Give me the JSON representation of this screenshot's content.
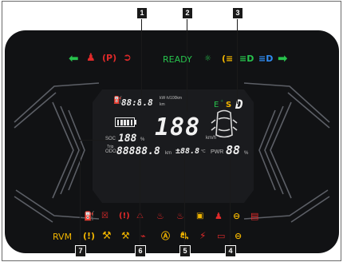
{
  "status_row": {
    "left_turn_icon": "left-turn-arrow-icon",
    "seatbelt_icon": "seatbelt-warning-icon",
    "parking_brake_icon": "parking-brake-icon",
    "power_limit_icon": "power-limit-turtle-icon",
    "ready_text": "READY",
    "position_lamp_icon": "position-lamp-icon",
    "rear_fog_icon": "rear-fog-icon",
    "low_beam_icon": "low-beam-icon",
    "high_beam_icon": "high-beam-icon",
    "right_turn_icon": "right-turn-arrow-icon"
  },
  "display": {
    "energy_value": "88:8.8",
    "energy_unit_top": "kW·h/100km",
    "energy_unit_bottom": "km",
    "gear_eco": "E",
    "gear_sport": "S",
    "gear_sep": "⁺",
    "gear_value": "D",
    "soc_label": "SOC",
    "soc_value": "188",
    "soc_unit": "%",
    "speed_value": "188",
    "speed_unit": "km/h",
    "trip_label": "Trip",
    "odo_label": "ODO",
    "odo_value": "88888.8",
    "odo_unit": "km",
    "temp_value": "±88.8",
    "temp_unit": "°C",
    "pwr_label": "PWR",
    "pwr_value": "88",
    "pwr_unit": "%"
  },
  "warning_row_1": [
    "low-fuel-icon",
    "motor-fault-icon",
    "brake-system-icon",
    "vehicle-fault-icon",
    "coolant-temp-icon",
    "oil-pressure-icon",
    "battery-fault-icon",
    "airbag-icon",
    "steering-fault-icon",
    "dc-battery-icon"
  ],
  "warning_row_2": {
    "rvm_text": "RVM",
    "icons": [
      "tpms-icon",
      "service-wrench-icon",
      "battery-service-icon",
      "high-voltage-fault-icon",
      "abs-icon",
      "traction-control-icon",
      "pedestrian-alert-icon",
      "charging-icon",
      "eps-icon"
    ]
  },
  "callouts": [
    "1",
    "2",
    "3",
    "4",
    "5",
    "6",
    "7"
  ],
  "colors": {
    "green": "#27c24c",
    "red": "#e02a2a",
    "amber": "#f0b400",
    "blue": "#2f8bf0",
    "bezel": "#111214"
  }
}
